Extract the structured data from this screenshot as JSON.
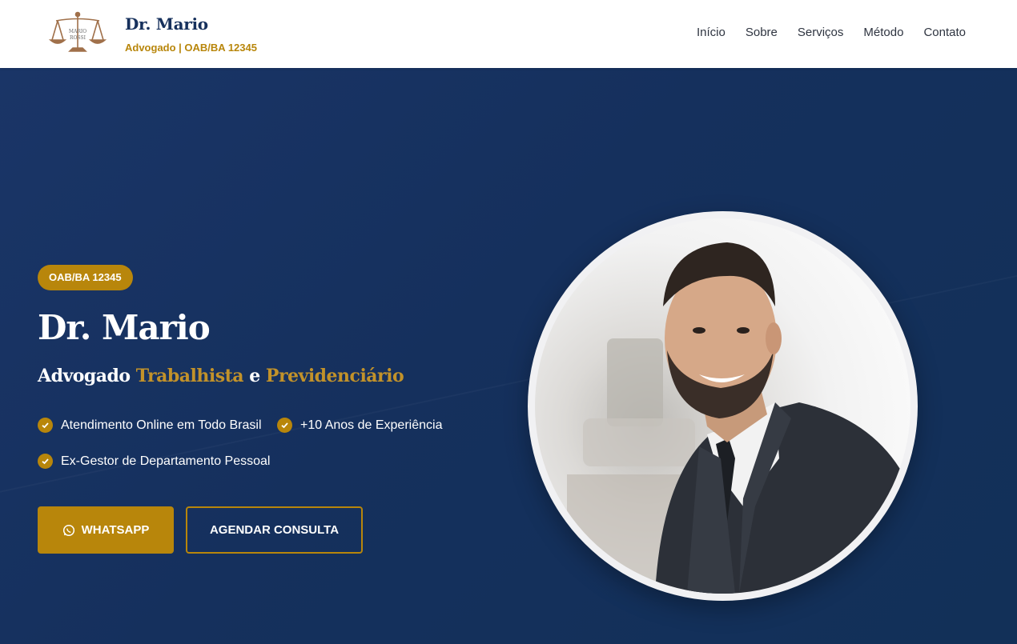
{
  "header": {
    "brand_name": "Dr. Mario",
    "brand_sub": "Advogado | OAB/BA 12345",
    "logo_text_top": "MARIO",
    "logo_text_bottom": "ROSSI",
    "nav": [
      {
        "label": "Início"
      },
      {
        "label": "Sobre"
      },
      {
        "label": "Serviços"
      },
      {
        "label": "Método"
      },
      {
        "label": "Contato"
      }
    ]
  },
  "hero": {
    "badge": "OAB/BA 12345",
    "title": "Dr. Mario",
    "subtitle_part1": "Advogado",
    "subtitle_part2": "Trabalhista",
    "subtitle_part3": "e",
    "subtitle_part4": "Previdenciário",
    "features": [
      {
        "label": "Atendimento Online em Todo Brasil",
        "icon": "check-circle-icon"
      },
      {
        "label": "+10 Anos de Experiência",
        "icon": "check-circle-icon"
      },
      {
        "label": "Ex-Gestor de Departamento Pessoal",
        "icon": "check-circle-icon"
      }
    ],
    "buttons": {
      "whatsapp": "WHATSAPP",
      "consulta": "AGENDAR CONSULTA"
    }
  },
  "colors": {
    "primary": "#16305c",
    "gold": "#b8860b",
    "background": "#162f5e"
  }
}
